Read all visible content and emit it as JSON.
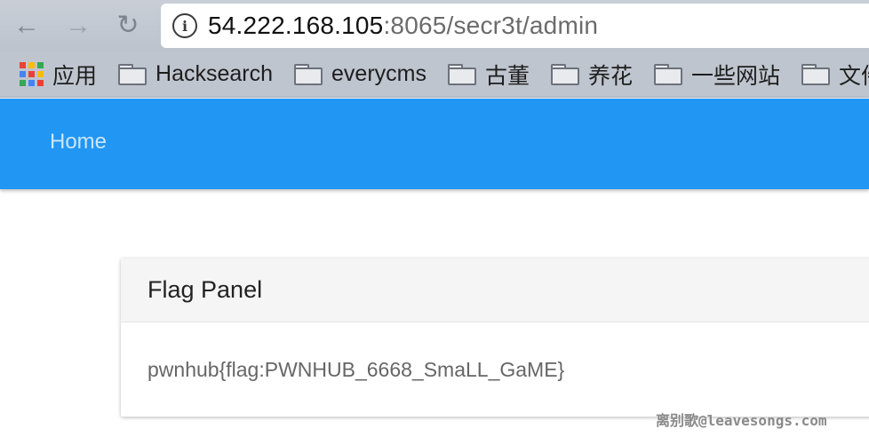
{
  "browser": {
    "url_host": "54.222.168.105",
    "url_rest": ":8065/secr3t/admin",
    "bookmarks": [
      {
        "label": "应用",
        "icon": "apps-grid-icon"
      },
      {
        "label": "Hacksearch",
        "icon": "folder-icon"
      },
      {
        "label": "everycms",
        "icon": "folder-icon"
      },
      {
        "label": "古董",
        "icon": "folder-icon"
      },
      {
        "label": "养花",
        "icon": "folder-icon"
      },
      {
        "label": "一些网站",
        "icon": "folder-icon"
      },
      {
        "label": "文件",
        "icon": "folder-icon"
      }
    ]
  },
  "navbar": {
    "home_label": "Home",
    "color": "#2196f3"
  },
  "panel": {
    "title": "Flag Panel",
    "content": "pwnhub{flag:PWNHUB_6668_SmaLL_GaME}"
  },
  "watermark": "离别歌@leavesongs.com"
}
